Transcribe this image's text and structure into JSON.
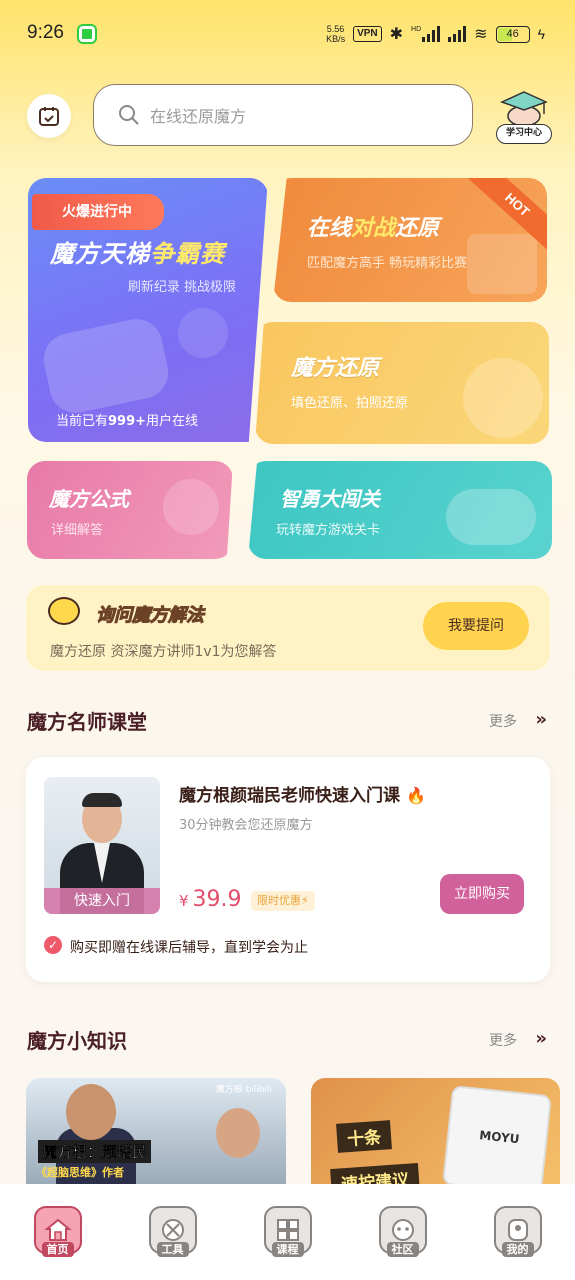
{
  "status_bar": {
    "time": "9:26",
    "speed_value": "5.56",
    "speed_unit": "KB/s",
    "vpn": "VPN",
    "hd": "HD",
    "battery": "46"
  },
  "header": {
    "search_placeholder": "在线还原魔方",
    "study_center": "学习中心"
  },
  "cards": {
    "ladder": {
      "badge": "火爆进行中",
      "title_main": "魔方天梯",
      "title_highlight": "争霸赛",
      "subtitle": "刷新纪录 挑战极限",
      "online_prefix": "当前已有",
      "online_count": "999+",
      "online_suffix": "用户在线"
    },
    "battle": {
      "title_prefix": "在线",
      "title_highlight": "对战",
      "title_suffix": "还原",
      "subtitle": "匹配魔方高手 畅玩精彩比赛",
      "hot": "HOT"
    },
    "restore": {
      "title": "魔方还原",
      "subtitle": "填色还原、拍照还原"
    },
    "formula": {
      "title": "魔方公式",
      "subtitle": "详细解答"
    },
    "brave": {
      "title": "智勇大闯关",
      "subtitle": "玩转魔方游戏关卡"
    }
  },
  "ask": {
    "title": "询问魔方解法",
    "subtitle": "魔方还原 资深魔方讲师1v1为您解答",
    "button": "我要提问"
  },
  "teacher_section": {
    "title": "魔方名师课堂",
    "more": "更多",
    "course": {
      "thumb_label": "快速入门",
      "title": "魔方根颜瑞民老师快速入门课",
      "subtitle": "30分钟教会您还原魔方",
      "currency": "¥",
      "price": "39.9",
      "limit_badge": "限时优惠⚡",
      "buy_button": "立即购买",
      "note": "购买即赠在线课后辅导，直到学会为止"
    }
  },
  "knowledge_section": {
    "title": "魔方小知识",
    "more": "更多",
    "item1": {
      "name": "魔方根：颜瑞民",
      "sub": "《超脑思维》作者",
      "logo": "魔方根 bilibili"
    },
    "item2": {
      "tag1": "十条",
      "tag2": "速拧建议",
      "cube_logo": "MOYU"
    }
  },
  "bottom_nav": {
    "items": [
      {
        "label": "首页",
        "icon": "home-icon"
      },
      {
        "label": "工具",
        "icon": "tools-icon"
      },
      {
        "label": "课程",
        "icon": "course-icon"
      },
      {
        "label": "社区",
        "icon": "community-icon"
      },
      {
        "label": "我的",
        "icon": "profile-icon"
      }
    ],
    "active_index": 0
  },
  "colors": {
    "accent_pink": "#d1619b",
    "price_red": "#e34d6c",
    "ask_button": "#ffd34d"
  }
}
